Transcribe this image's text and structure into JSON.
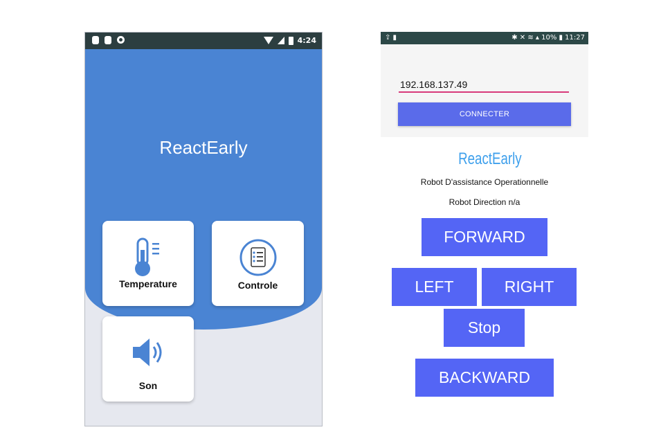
{
  "left_app": {
    "status_bar": {
      "time": "4:24"
    },
    "title": "ReactEarly",
    "cards": [
      {
        "label": "Temperature",
        "icon": "thermometer-icon"
      },
      {
        "label": "Controle",
        "icon": "checklist-icon"
      },
      {
        "label": "Son",
        "icon": "speaker-icon"
      }
    ],
    "colors": {
      "hero": "#4a84d3",
      "background": "#e6e8ef",
      "icon_blue": "#4a84d3"
    }
  },
  "right_app": {
    "status_bar": {
      "left": "⇪ ▮",
      "right": "✱ ✕ ≋ ▴ 10% ▮ 11:27"
    },
    "ip_input": {
      "value": "192.168.137.49"
    },
    "connect_label": "CONNECTER",
    "brand": "ReactEarly",
    "subtitle": "Robot D'assistance Operationnelle",
    "direction": "Robot Direction n/a",
    "controls": {
      "forward": "FORWARD",
      "left": "LEFT",
      "right": "RIGHT",
      "stop": "Stop",
      "backward": "BACKWARD"
    },
    "colors": {
      "button": "#5465f5",
      "connect": "#5a6bea",
      "underline": "#d8397a",
      "brand": "#3fa0ec"
    }
  }
}
